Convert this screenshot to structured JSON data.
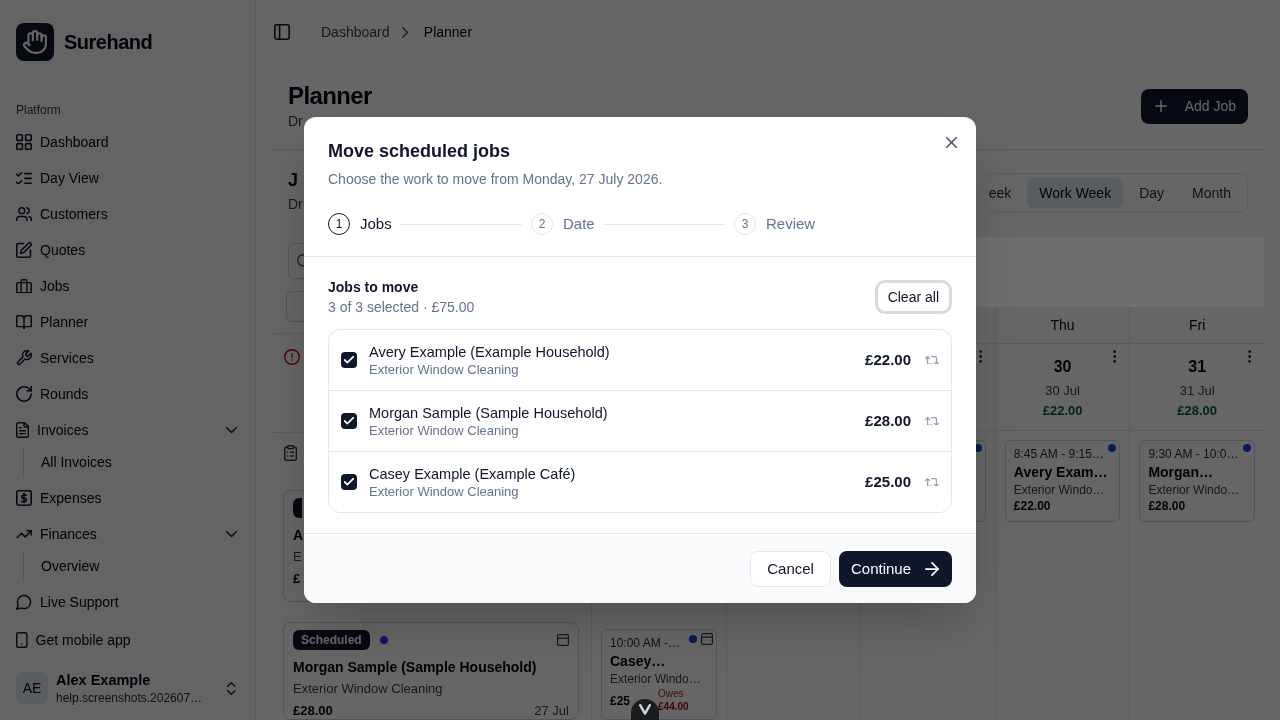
{
  "sidebar": {
    "brand": "Surehand",
    "section_label": "Platform",
    "items": [
      {
        "kind": "link",
        "label": "Dashboard"
      },
      {
        "kind": "link",
        "label": "Day View"
      },
      {
        "kind": "link",
        "label": "Customers"
      },
      {
        "kind": "link",
        "label": "Quotes"
      },
      {
        "kind": "link",
        "label": "Jobs"
      },
      {
        "kind": "link",
        "label": "Planner"
      },
      {
        "kind": "link",
        "label": "Services"
      },
      {
        "kind": "link",
        "label": "Rounds"
      },
      {
        "kind": "group",
        "label": "Invoices",
        "expanded": true,
        "children": [
          {
            "label": "All Invoices"
          }
        ]
      },
      {
        "kind": "link",
        "label": "Expenses"
      },
      {
        "kind": "group",
        "label": "Finances",
        "expanded": true,
        "children": [
          {
            "label": "Overview"
          }
        ]
      },
      {
        "kind": "link",
        "label": "Live Support"
      }
    ],
    "mobile_app": "Get mobile app",
    "user": {
      "initials": "AE",
      "name": "Alex Example",
      "email": "help.screenshots.202607…"
    }
  },
  "breadcrumb": [
    {
      "label": "Dashboard"
    },
    {
      "label": "Planner"
    }
  ],
  "page": {
    "title": "Planner",
    "description": "Dr",
    "add_button": "Add Job"
  },
  "jobs_panel": {
    "title": "J",
    "description": "Dr",
    "cards": [
      {
        "badge": true,
        "name": "A",
        "service": "E",
        "price": "£"
      },
      {
        "status": "Scheduled",
        "dot": true,
        "badge_icon": true,
        "name": "Morgan Sample (Sample Household)",
        "service": "Exterior Window Cleaning",
        "price": "£28.00",
        "date": "27 Jul"
      }
    ]
  },
  "view_tabs": [
    {
      "label": "eek",
      "selected": false
    },
    {
      "label": "Work Week",
      "selected": true
    },
    {
      "label": "Day",
      "selected": false
    },
    {
      "label": "Month",
      "selected": false
    }
  ],
  "calendar": {
    "earlier_events": [
      {
        "time": "10:00 AM -…",
        "name": "Casey…",
        "service": "Exterior Windo…",
        "price": "£25",
        "balance_label": "Owes",
        "balance": "£44.00",
        "dot": true,
        "badge_icon": true
      }
    ],
    "days": [
      {
        "menu": true,
        "events": [
          {
            "dot": true
          }
        ]
      },
      {
        "name": "Thu",
        "date": "30",
        "date_label": "30 Jul",
        "total": "£22.00",
        "menu": true,
        "events": [
          {
            "time": "8:45 AM - 9:15…",
            "name": "Avery Exam…",
            "service": "Exterior Windo…",
            "price": "£22.00",
            "dot": true
          }
        ]
      },
      {
        "name": "Fri",
        "date": "31",
        "date_label": "31 Jul",
        "total": "£28.00",
        "menu": true,
        "events": [
          {
            "time": "9:30 AM - 10:0…",
            "name": "Morgan…",
            "service": "Exterior Windo…",
            "price": "£28.00",
            "dot": true
          }
        ]
      }
    ]
  },
  "dialog": {
    "title": "Move scheduled jobs",
    "description": "Choose the work to move from Monday, 27 July 2026.",
    "steps": [
      {
        "number": "1",
        "label": "Jobs",
        "selected": true
      },
      {
        "number": "2",
        "label": "Date",
        "selected": false
      },
      {
        "number": "3",
        "label": "Review",
        "selected": false
      }
    ],
    "section_title": "Jobs to move",
    "summary": "3 of 3 selected · £75.00",
    "clear_button": {
      "label": "Clear all",
      "focused": true
    },
    "jobs": [
      {
        "name": "Avery Example (Example Household)",
        "service": "Exterior Window Cleaning",
        "price": "£22.00",
        "checked": true,
        "recurring": true
      },
      {
        "name": "Morgan Sample (Sample Household)",
        "service": "Exterior Window Cleaning",
        "price": "£28.00",
        "checked": true,
        "recurring": true
      },
      {
        "name": "Casey Example (Example Café)",
        "service": "Exterior Window Cleaning",
        "price": "£25.00",
        "checked": true,
        "recurring": true
      }
    ],
    "cancel_button": "Cancel",
    "continue_button": "Continue"
  }
}
